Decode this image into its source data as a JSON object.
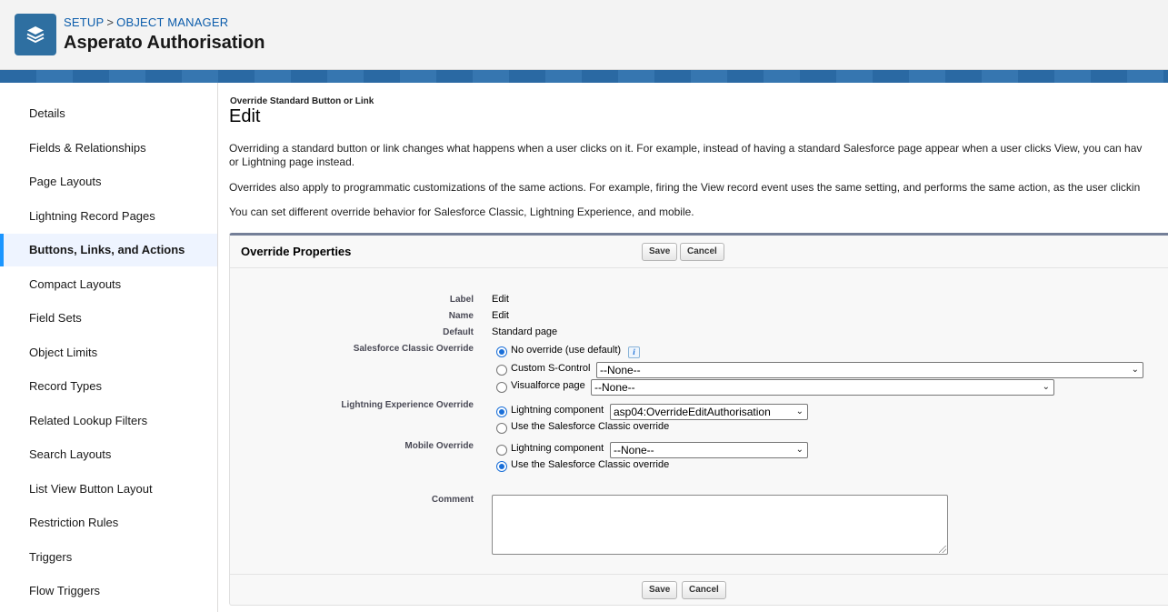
{
  "header": {
    "breadcrumb": {
      "setup": "SETUP",
      "separator": ">",
      "object_manager": "OBJECT MANAGER"
    },
    "title": "Asperato Authorisation",
    "logo_icon": "layers-icon",
    "brand_color": "#2e6fa1"
  },
  "sidebar": {
    "items": [
      {
        "label": "Details"
      },
      {
        "label": "Fields & Relationships"
      },
      {
        "label": "Page Layouts"
      },
      {
        "label": "Lightning Record Pages"
      },
      {
        "label": "Buttons, Links, and Actions",
        "active": true
      },
      {
        "label": "Compact Layouts"
      },
      {
        "label": "Field Sets"
      },
      {
        "label": "Object Limits"
      },
      {
        "label": "Record Types"
      },
      {
        "label": "Related Lookup Filters"
      },
      {
        "label": "Search Layouts"
      },
      {
        "label": "List View Button Layout"
      },
      {
        "label": "Restriction Rules"
      },
      {
        "label": "Triggers"
      },
      {
        "label": "Flow Triggers"
      }
    ],
    "active_color": "#1b96ff"
  },
  "main": {
    "section_label": "Override Standard Button or Link",
    "title": "Edit",
    "paragraph1_line1": "Overriding a standard button or link changes what happens when a user clicks on it. For example, instead of having a standard Salesforce page appear when a user clicks View, you can hav",
    "paragraph1_line2": "or Lightning page instead.",
    "paragraph2": "Overrides also apply to programmatic customizations of the same actions. For example, firing the View record event uses the same setting, and performs the same action, as the user clickin",
    "paragraph3": "You can set different override behavior for Salesforce Classic, Lightning Experience, and mobile."
  },
  "panel": {
    "title": "Override Properties",
    "save_label": "Save",
    "cancel_label": "Cancel",
    "fields": {
      "label_label": "Label",
      "label_value": "Edit",
      "name_label": "Name",
      "name_value": "Edit",
      "default_label": "Default",
      "default_value": "Standard page",
      "classic_label": "Salesforce Classic Override",
      "classic_opt1": "No override (use default)",
      "classic_opt2": "Custom S-Control",
      "classic_opt2_select": "--None--",
      "classic_opt3": "Visualforce page",
      "classic_opt3_select": "--None--",
      "lightning_label": "Lightning Experience Override",
      "lightning_opt1": "Lightning component",
      "lightning_opt1_select": "asp04:OverrideEditAuthorisation",
      "lightning_opt2": "Use the Salesforce Classic override",
      "mobile_label": "Mobile Override",
      "mobile_opt1": "Lightning component",
      "mobile_opt1_select": "--None--",
      "mobile_opt2": "Use the Salesforce Classic override",
      "comment_label": "Comment",
      "comment_value": ""
    },
    "info_icon": "info-icon"
  }
}
